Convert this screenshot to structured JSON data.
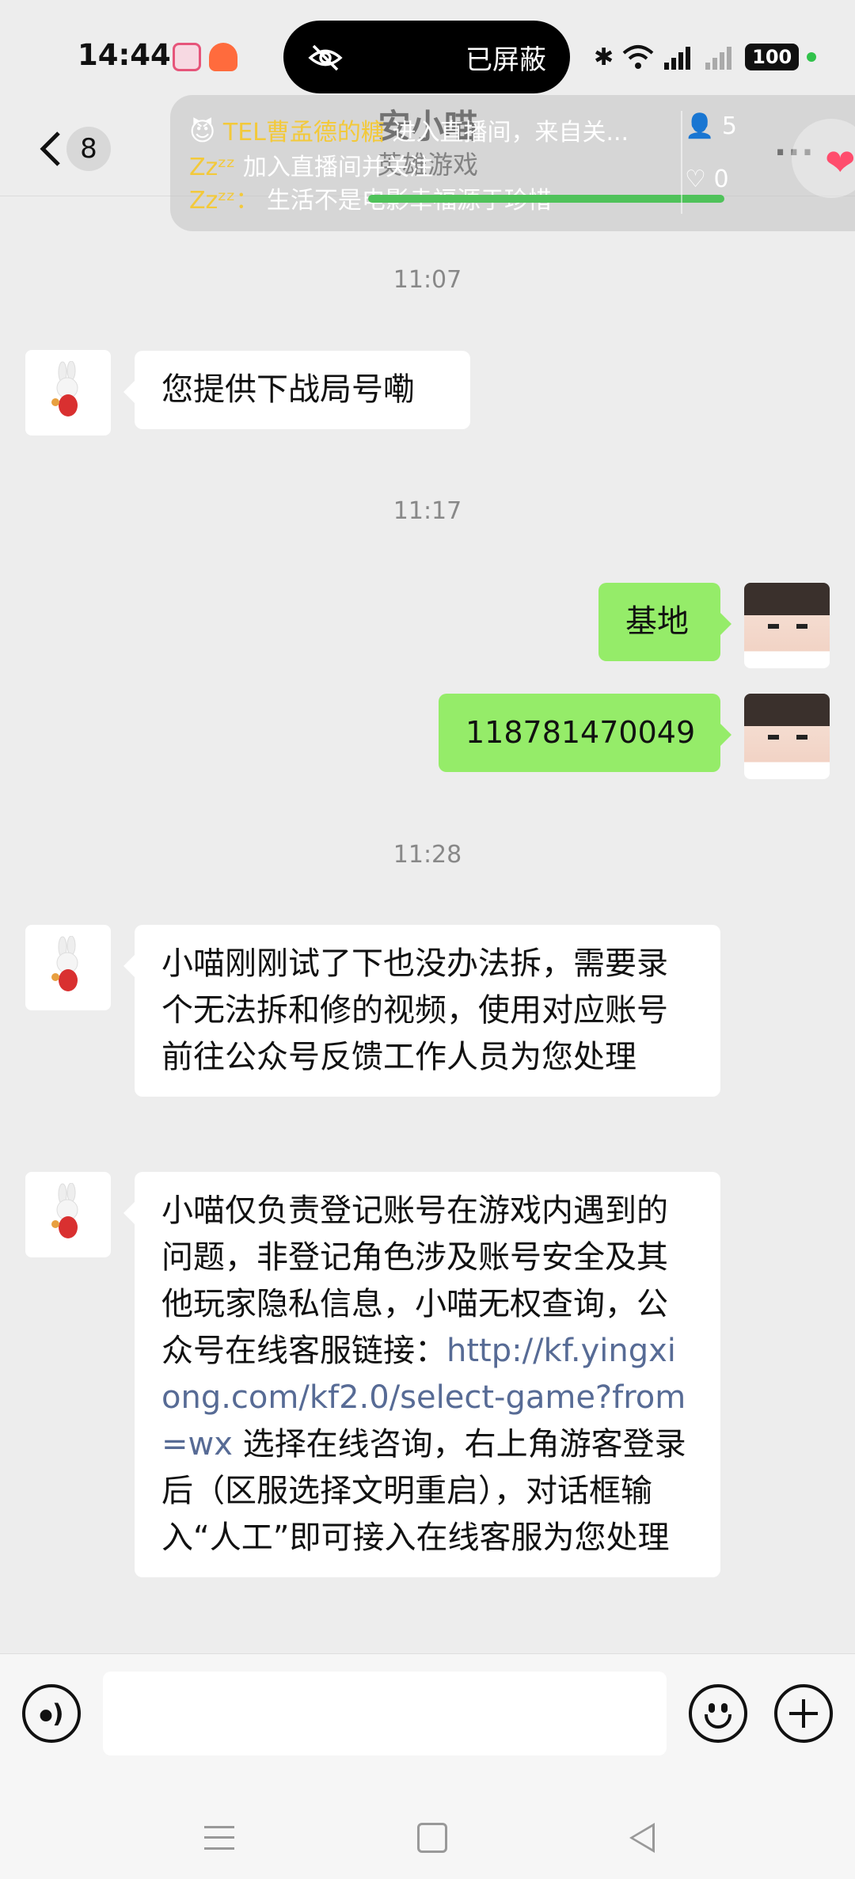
{
  "status_bar": {
    "time": "14:44",
    "privacy_label": "已屏蔽",
    "battery": "100",
    "icons": [
      "bluetooth-icon",
      "wifi-icon",
      "signal-5g-icon",
      "signal-icon"
    ]
  },
  "header": {
    "back_count": "8",
    "title": "安小喵",
    "subtitle": "英雄游戏",
    "more": "···"
  },
  "live_overlay": {
    "line1_name": "TEL曹孟德的糖",
    "line1_text": "进入直播间，来自关...",
    "line2_name": "Zzᶻᶻ",
    "line2_text": "加入直播间并关注",
    "line3_name": "Zzᶻᶻ：",
    "line3_text": "生活不是电影幸福源于珍惜",
    "viewers": "5",
    "likes": "0"
  },
  "messages": [
    {
      "type": "time",
      "text": "11:07"
    },
    {
      "type": "in",
      "text": "您提供下战局号嘞"
    },
    {
      "type": "time",
      "text": "11:17"
    },
    {
      "type": "out",
      "text": "基地"
    },
    {
      "type": "out",
      "text": "118781470049"
    },
    {
      "type": "time",
      "text": "11:28"
    },
    {
      "type": "in",
      "text": "小喵刚刚试了下也没办法拆，需要录个无法拆和修的视频，使用对应账号前往公众号反馈工作人员为您处理"
    },
    {
      "type": "in",
      "text_before": "小喵仅负责登记账号在游戏内遇到的问题，非登记角色涉及账号安全及其他玩家隐私信息，小喵无权查询，公众号在线客服链接：",
      "link": "http://kf.yingxiong.com/kf2.0/select-game?from=wx",
      "text_after": " 选择在线咨询，右上角游客登录后（区服选择文明重启），对话框输入“人工”即可接入在线客服为您处理"
    }
  ],
  "input_bar": {
    "placeholder": ""
  },
  "colors": {
    "out_bubble": "#95ec69",
    "in_bubble": "#ffffff",
    "link": "#576b95",
    "background": "#ededed"
  }
}
